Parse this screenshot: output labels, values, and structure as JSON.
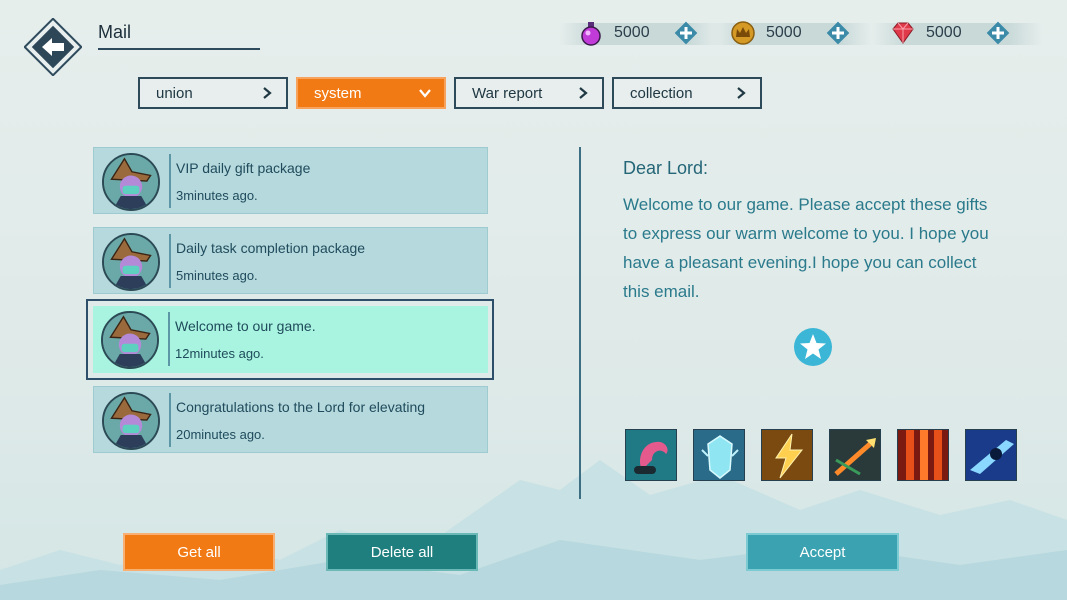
{
  "header": {
    "title": "Mail"
  },
  "currencies": [
    {
      "icon": "potion-icon",
      "value": "5000"
    },
    {
      "icon": "crown-coin-icon",
      "value": "5000"
    },
    {
      "icon": "ruby-gem-icon",
      "value": "5000"
    }
  ],
  "tabs": [
    {
      "label": "union",
      "active": false
    },
    {
      "label": "system",
      "active": true
    },
    {
      "label": "War report",
      "active": false
    },
    {
      "label": "collection",
      "active": false
    }
  ],
  "mails": [
    {
      "title": "VIP daily gift package",
      "time": "3minutes ago."
    },
    {
      "title": "Daily task completion package",
      "time": "5minutes ago."
    },
    {
      "title": "Welcome to our game.",
      "time": "12minutes ago.",
      "selected": true
    },
    {
      "title": "Congratulations to the Lord for elevating",
      "time": "20minutes ago."
    }
  ],
  "detail": {
    "greeting": "Dear Lord:",
    "body": "Welcome to our game. Please accept these gifts  to express our warm welcome to you. I hope you have a pleasant evening.I hope you can collect this email.",
    "rewards": [
      "scythe-skill-icon",
      "ice-shield-skill-icon",
      "lightning-skill-icon",
      "flame-arrow-skill-icon",
      "fire-pillar-skill-icon",
      "shadow-dash-skill-icon"
    ]
  },
  "buttons": {
    "get_all": "Get all",
    "delete_all": "Delete all",
    "accept": "Accept"
  },
  "colors": {
    "orange": "#f27a14",
    "teal_dark": "#1f7f7e",
    "teal": "#3aa2b0",
    "selected_mail": "#a9f4e0",
    "mail_bg": "#b6d9dd"
  }
}
